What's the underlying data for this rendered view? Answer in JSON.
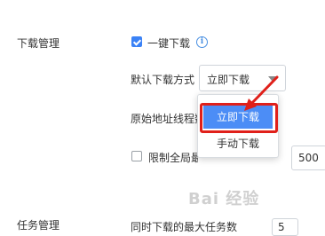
{
  "sections": {
    "download_mgmt": "下载管理",
    "task_mgmt": "任务管理"
  },
  "one_click": {
    "label": "一键下载",
    "checked": true,
    "info_icon": "info-icon"
  },
  "default_mode": {
    "label": "默认下载方式",
    "selected": "立即下载",
    "options": [
      "立即下载",
      "手动下载"
    ]
  },
  "origin_thread_label": "原始地址线程数",
  "limit_global": {
    "label": "限制全局最",
    "checked": false,
    "value": "500"
  },
  "bottom_row": {
    "label": "同时下载的最大任务数",
    "value": "5"
  },
  "watermark": "Bai 经验",
  "colors": {
    "accent": "#3b82f6",
    "highlight_red": "#e0201a",
    "selected_option": "#4c8df6"
  }
}
